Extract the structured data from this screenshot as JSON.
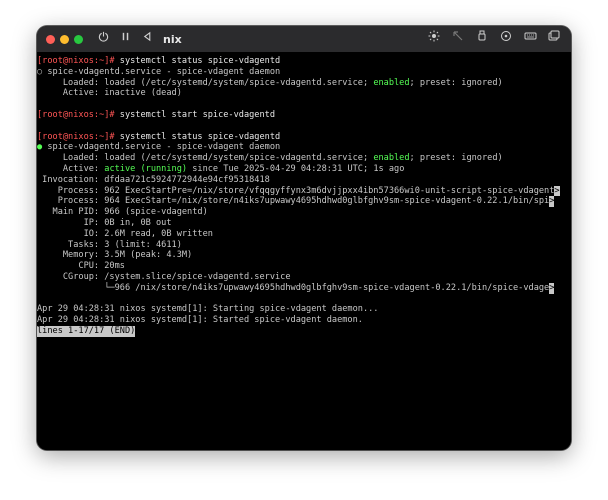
{
  "window": {
    "vm_name": "nix",
    "icons_left": [
      "power-icon",
      "pause-icon",
      "back-icon"
    ],
    "icons_right": [
      "brightness-icon",
      "pointer-icon",
      "usb-icon",
      "disk-icon",
      "keyboard-icon",
      "window-icon"
    ]
  },
  "terminal": {
    "block1": {
      "prompt": "[root@nixos:~]#",
      "command": " systemctl status spice-vdagentd",
      "status_bullet": "○",
      "unit_line": " spice-vdagentd.service - spice-vdagent daemon",
      "loaded_pre": "     Loaded: loaded (/etc/systemd/system/spice-vdagentd.service; ",
      "loaded_enabled": "enabled",
      "loaded_post": "; preset: ignored)",
      "active": "     Active: inactive (dead)"
    },
    "block2": {
      "prompt": "[root@nixos:~]#",
      "command": " systemctl start spice-vdagentd"
    },
    "block3": {
      "prompt": "[root@nixos:~]#",
      "command": " systemctl status spice-vdagentd",
      "status_bullet": "●",
      "unit_line": " spice-vdagentd.service - spice-vdagent daemon",
      "loaded_pre": "     Loaded: loaded (/etc/systemd/system/spice-vdagentd.service; ",
      "loaded_enabled": "enabled",
      "loaded_post": "; preset: ignored)",
      "active_pre": "     Active: ",
      "active_running": "active (running)",
      "active_post": " since Tue 2025-04-29 04:28:31 UTC; 1s ago",
      "invocation": " Invocation: dfdaa721c5924772944e94cf95318418",
      "process1": "    Process: 962 ExecStartPre=/nix/store/vfqqgyffynx3m6dvjjpxx4ibn57366wi0-unit-script-spice-vdagent",
      "process2": "    Process: 964 ExecStart=/nix/store/n4iks7upwawy4695hdhwd0glbfghv9sm-spice-vdagent-0.22.1/bin/spi",
      "mainpid": "   Main PID: 966 (spice-vdagentd)",
      "ip": "         IP: 0B in, 0B out",
      "io": "         IO: 2.6M read, 0B written",
      "tasks": "      Tasks: 3 (limit: 4611)",
      "memory": "     Memory: 3.5M (peak: 4.3M)",
      "cpu": "        CPU: 20ms",
      "cgroup": "     CGroup: /system.slice/spice-vdagentd.service",
      "cgroup_child": "             └─966 /nix/store/n4iks7upwawy4695hdhwd0glbfghv9sm-spice-vdagent-0.22.1/bin/spice-vdage",
      "log1": "Apr 29 04:28:31 nixos systemd[1]: Starting spice-vdagent daemon...",
      "log2": "Apr 29 04:28:31 nixos systemd[1]: Started spice-vdagent daemon.",
      "pager": "lines 1-17/17 (END)"
    },
    "truncation_marker": ">"
  }
}
